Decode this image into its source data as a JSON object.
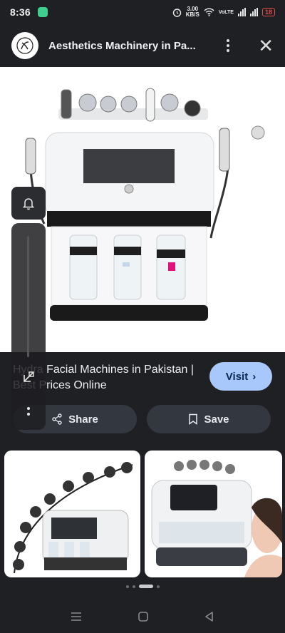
{
  "status": {
    "time": "8:36",
    "speed_value": "3.00",
    "speed_unit": "KB/S",
    "volte": "VoLTE",
    "battery": "18"
  },
  "header": {
    "title": "Aesthetics Machinery in Pa..."
  },
  "result": {
    "title": "Hydra Facial Machines in Pakistan | Best Prices Online",
    "visit_label": "Visit",
    "share_label": "Share",
    "save_label": "Save"
  },
  "icons": {
    "logo": "site-logo",
    "menu": "more-vert-icon",
    "close": "close-icon",
    "bell": "bell-icon",
    "collapse": "collapse-icon",
    "share": "share-icon",
    "save": "bookmark-icon"
  },
  "colors": {
    "accent": "#a8c7fa",
    "background": "#1f2024",
    "pill": "#33373f"
  },
  "pager": {
    "count": 5,
    "active_index": 2
  }
}
